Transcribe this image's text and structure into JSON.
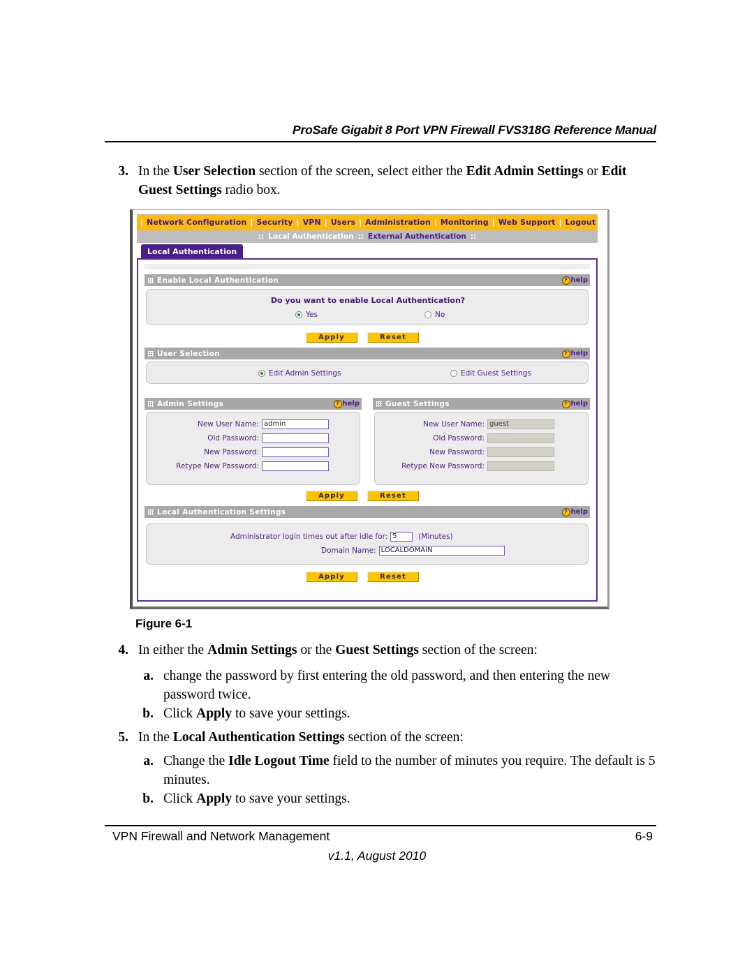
{
  "header": {
    "running_title": "ProSafe Gigabit 8 Port VPN Firewall FVS318G Reference Manual"
  },
  "steps": {
    "step3": {
      "number": "3.",
      "parts": [
        {
          "text": "In the ",
          "bold": false
        },
        {
          "text": "User Selection",
          "bold": true
        },
        {
          "text": " section of the screen, select either the ",
          "bold": false
        },
        {
          "text": "Edit Admin Settings",
          "bold": true
        },
        {
          "text": " or ",
          "bold": false
        },
        {
          "text": "Edit Guest Settings",
          "bold": true
        },
        {
          "text": " radio box.",
          "bold": false
        }
      ]
    },
    "step4": {
      "number": "4.",
      "parts": [
        {
          "text": "In either the ",
          "bold": false
        },
        {
          "text": "Admin Settings",
          "bold": true
        },
        {
          "text": " or the ",
          "bold": false
        },
        {
          "text": "Guest Settings",
          "bold": true
        },
        {
          "text": " section of the screen:",
          "bold": false
        }
      ]
    },
    "step4a": {
      "number": "a.",
      "parts": [
        {
          "text": "change the password by first entering the old password, and then entering the new password twice.",
          "bold": false
        }
      ]
    },
    "step4b": {
      "number": "b.",
      "parts": [
        {
          "text": "Click ",
          "bold": false
        },
        {
          "text": "Apply",
          "bold": true
        },
        {
          "text": " to save your settings.",
          "bold": false
        }
      ]
    },
    "step5": {
      "number": "5.",
      "parts": [
        {
          "text": "In the ",
          "bold": false
        },
        {
          "text": "Local Authentication Settings",
          "bold": true
        },
        {
          "text": " section of the screen:",
          "bold": false
        }
      ]
    },
    "step5a": {
      "number": "a.",
      "parts": [
        {
          "text": "Change the ",
          "bold": false
        },
        {
          "text": "Idle Logout Time",
          "bold": true
        },
        {
          "text": " field to the number of minutes you require. The default is 5 minutes.",
          "bold": false
        }
      ]
    },
    "step5b": {
      "number": "b.",
      "parts": [
        {
          "text": "Click ",
          "bold": false
        },
        {
          "text": "Apply",
          "bold": true
        },
        {
          "text": " to save your settings.",
          "bold": false
        }
      ]
    }
  },
  "figure": {
    "caption": "Figure 6-1",
    "colors": {
      "nav_orange": "#ffb400",
      "purple": "#4b1e8c",
      "header_grey": "#a8a8a8",
      "panel_grey": "#ececec",
      "button_yellow": "#ffc400",
      "radio_green": "#0a8f2a"
    },
    "screen": {
      "main_nav": [
        "Network Configuration",
        "Security",
        "VPN",
        "Users",
        "Administration",
        "Monitoring",
        "Web Support",
        "Logout"
      ],
      "sub_nav": {
        "prefix": "::",
        "items": [
          {
            "label": "Local Authentication",
            "current": true
          },
          {
            "label": "External Authentication",
            "current": false
          }
        ],
        "suffix": "::"
      },
      "page_tab": "Local Authentication",
      "help_label": "help",
      "sections": [
        {
          "id": "enable-local-authentication",
          "title": "Enable Local Authentication",
          "help": "help",
          "question": "Do you want to enable Local Authentication?",
          "options": [
            {
              "label": "Yes",
              "selected": true
            },
            {
              "label": "No",
              "selected": false
            }
          ]
        },
        {
          "id": "user-selection",
          "title": "User Selection",
          "help": "help",
          "options": [
            {
              "label": "Edit Admin Settings",
              "selected": true
            },
            {
              "label": "Edit Guest Settings",
              "selected": false
            }
          ]
        },
        {
          "id": "admin-settings",
          "title": "Admin Settings",
          "help": "help",
          "fields": [
            {
              "label": "New User Name:",
              "value": "admin",
              "disabled": false
            },
            {
              "label": "Old Password:",
              "value": "",
              "disabled": false
            },
            {
              "label": "New Password:",
              "value": "",
              "disabled": false
            },
            {
              "label": "Retype New Password:",
              "value": "",
              "disabled": false
            }
          ]
        },
        {
          "id": "guest-settings",
          "title": "Guest Settings",
          "help": "help",
          "fields": [
            {
              "label": "New User Name:",
              "value": "guest",
              "disabled": true
            },
            {
              "label": "Old Password:",
              "value": "",
              "disabled": true
            },
            {
              "label": "New Password:",
              "value": "",
              "disabled": true
            },
            {
              "label": "Retype New Password:",
              "value": "",
              "disabled": true
            }
          ]
        },
        {
          "id": "local-authentication-settings",
          "title": "Local Authentication Settings",
          "help": "help",
          "idle_label": "Administrator login times out after idle for:",
          "idle_value": "5",
          "idle_units": "(Minutes)",
          "domain_label": "Domain Name:",
          "domain_value": "LOCALDOMAIN"
        }
      ],
      "buttons": {
        "apply": "Apply",
        "reset": "Reset"
      }
    }
  },
  "footer": {
    "left": "VPN Firewall and Network Management",
    "right": "6-9",
    "version": "v1.1, August 2010"
  }
}
